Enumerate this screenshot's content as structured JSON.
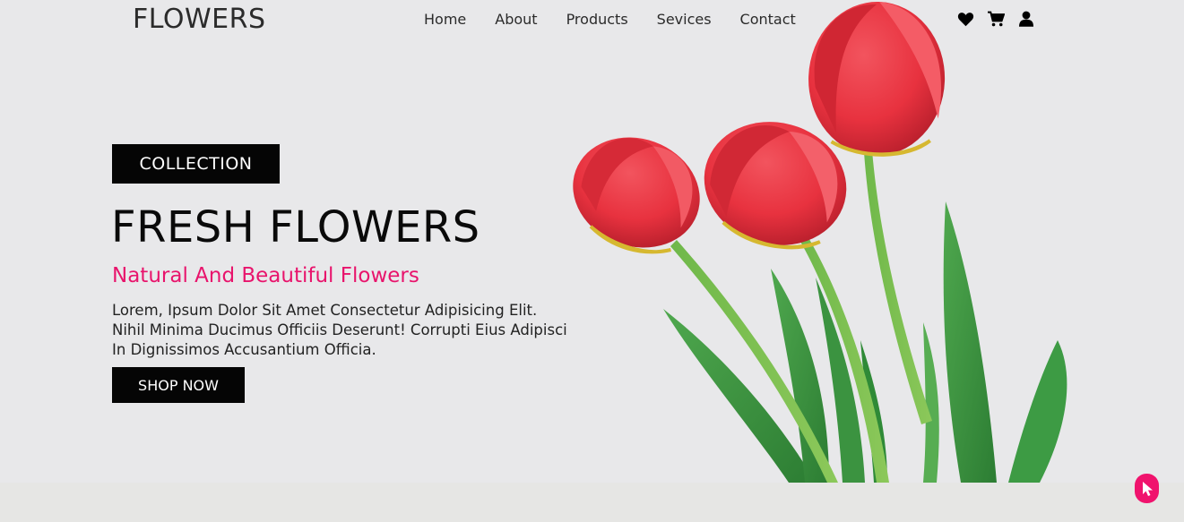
{
  "header": {
    "logo": "FLOWERS",
    "nav": [
      "Home",
      "About",
      "Products",
      "Sevices",
      "Contact"
    ],
    "icons": [
      "heart-icon",
      "cart-icon",
      "user-icon"
    ]
  },
  "hero": {
    "badge": "COLLECTION",
    "headline": "FRESH FLOWERS",
    "subtitle": "Natural And Beautiful Flowers",
    "description_lines": [
      "Lorem, Ipsum Dolor Sit Amet Consectetur Adipisicing Elit.",
      "Nihil Minima Ducimus Officiis Deserunt! Corrupti Eius Adipisci",
      "In Dignissimos Accusantium Officia."
    ],
    "button": "SHOP NOW"
  },
  "colors": {
    "accent": "#e8146c",
    "dark": "#050505",
    "background": "#e8e8ea"
  },
  "floating": {
    "icon": "pointer-cursor-icon"
  }
}
